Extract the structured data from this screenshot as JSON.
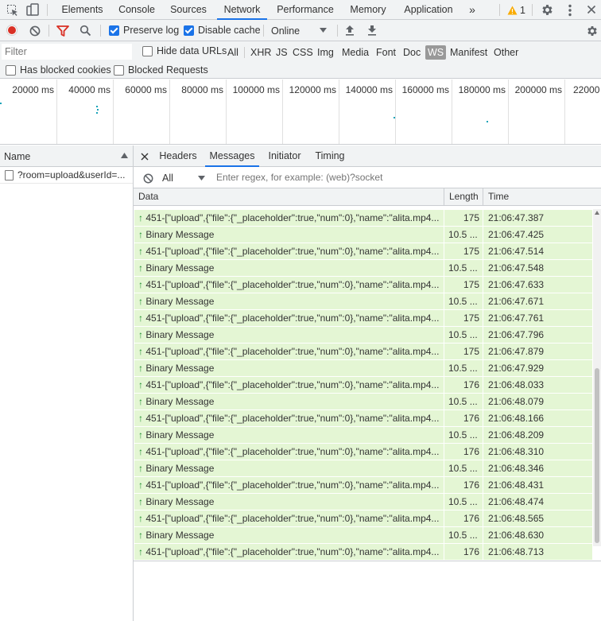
{
  "tabs": {
    "items": [
      "Elements",
      "Console",
      "Sources",
      "Network",
      "Performance",
      "Memory",
      "Application"
    ],
    "active": "Network",
    "more": "»",
    "warning_count": "1"
  },
  "toolbar": {
    "preserve_log": "Preserve log",
    "disable_cache": "Disable cache",
    "throttling": "Online"
  },
  "filter": {
    "placeholder": "Filter",
    "hide_data_urls": "Hide data URLs",
    "types": [
      "All",
      "XHR",
      "JS",
      "CSS",
      "Img",
      "Media",
      "Font",
      "Doc",
      "WS",
      "Manifest",
      "Other"
    ],
    "active_type": "WS",
    "has_blocked_cookies": "Has blocked cookies",
    "blocked_requests": "Blocked Requests"
  },
  "overview": {
    "ticks": [
      "20000 ms",
      "40000 ms",
      "60000 ms",
      "80000 ms",
      "100000 ms",
      "120000 ms",
      "140000 ms",
      "160000 ms",
      "180000 ms",
      "200000 ms",
      "22000"
    ]
  },
  "requests": {
    "header": "Name",
    "items": [
      "?room=upload&userId=..."
    ]
  },
  "detail": {
    "tabs": [
      "Headers",
      "Messages",
      "Initiator",
      "Timing"
    ],
    "active": "Messages",
    "filter_type": "All",
    "regex_placeholder": "Enter regex, for example: (web)?socket",
    "columns": [
      "Data",
      "Length",
      "Time"
    ],
    "messages": [
      {
        "data": "451-[\"upload\",{\"file\":{\"_placeholder\":true,\"num\":0},\"name\":\"alita.mp4...",
        "length": "175",
        "time": "21:06:47.387"
      },
      {
        "data": "Binary Message",
        "length": "10.5 ...",
        "time": "21:06:47.425"
      },
      {
        "data": "451-[\"upload\",{\"file\":{\"_placeholder\":true,\"num\":0},\"name\":\"alita.mp4...",
        "length": "175",
        "time": "21:06:47.514"
      },
      {
        "data": "Binary Message",
        "length": "10.5 ...",
        "time": "21:06:47.548"
      },
      {
        "data": "451-[\"upload\",{\"file\":{\"_placeholder\":true,\"num\":0},\"name\":\"alita.mp4...",
        "length": "175",
        "time": "21:06:47.633"
      },
      {
        "data": "Binary Message",
        "length": "10.5 ...",
        "time": "21:06:47.671"
      },
      {
        "data": "451-[\"upload\",{\"file\":{\"_placeholder\":true,\"num\":0},\"name\":\"alita.mp4...",
        "length": "175",
        "time": "21:06:47.761"
      },
      {
        "data": "Binary Message",
        "length": "10.5 ...",
        "time": "21:06:47.796"
      },
      {
        "data": "451-[\"upload\",{\"file\":{\"_placeholder\":true,\"num\":0},\"name\":\"alita.mp4...",
        "length": "175",
        "time": "21:06:47.879"
      },
      {
        "data": "Binary Message",
        "length": "10.5 ...",
        "time": "21:06:47.929"
      },
      {
        "data": "451-[\"upload\",{\"file\":{\"_placeholder\":true,\"num\":0},\"name\":\"alita.mp4...",
        "length": "176",
        "time": "21:06:48.033"
      },
      {
        "data": "Binary Message",
        "length": "10.5 ...",
        "time": "21:06:48.079"
      },
      {
        "data": "451-[\"upload\",{\"file\":{\"_placeholder\":true,\"num\":0},\"name\":\"alita.mp4...",
        "length": "176",
        "time": "21:06:48.166"
      },
      {
        "data": "Binary Message",
        "length": "10.5 ...",
        "time": "21:06:48.209"
      },
      {
        "data": "451-[\"upload\",{\"file\":{\"_placeholder\":true,\"num\":0},\"name\":\"alita.mp4...",
        "length": "176",
        "time": "21:06:48.310"
      },
      {
        "data": "Binary Message",
        "length": "10.5 ...",
        "time": "21:06:48.346"
      },
      {
        "data": "451-[\"upload\",{\"file\":{\"_placeholder\":true,\"num\":0},\"name\":\"alita.mp4...",
        "length": "176",
        "time": "21:06:48.431"
      },
      {
        "data": "Binary Message",
        "length": "10.5 ...",
        "time": "21:06:48.474"
      },
      {
        "data": "451-[\"upload\",{\"file\":{\"_placeholder\":true,\"num\":0},\"name\":\"alita.mp4...",
        "length": "176",
        "time": "21:06:48.565"
      },
      {
        "data": "Binary Message",
        "length": "10.5 ...",
        "time": "21:06:48.630"
      },
      {
        "data": "451-[\"upload\",{\"file\":{\"_placeholder\":true,\"num\":0},\"name\":\"alita.mp4...",
        "length": "176",
        "time": "21:06:48.713"
      }
    ]
  },
  "colors": {
    "accent": "#1a73e8",
    "sent_row": "#e4f6d4",
    "record": "#d93025",
    "filter_icon": "#d93025",
    "warning": "#f9ab00"
  }
}
